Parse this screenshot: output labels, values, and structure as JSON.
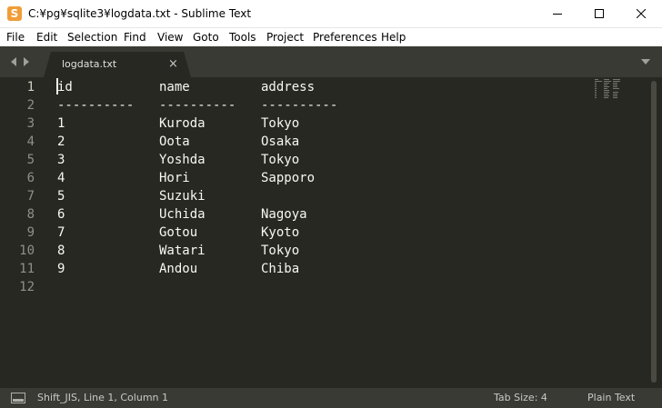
{
  "window": {
    "title": "C:¥pg¥sqlite3¥logdata.txt - Sublime Text",
    "app_icon_letter": "S"
  },
  "menu": [
    {
      "label": "File"
    },
    {
      "label": "Edit"
    },
    {
      "label": "Selection"
    },
    {
      "label": "Find"
    },
    {
      "label": "View"
    },
    {
      "label": "Goto"
    },
    {
      "label": "Tools"
    },
    {
      "label": "Project"
    },
    {
      "label": "Preferences"
    },
    {
      "label": "Help"
    }
  ],
  "tab": {
    "label": "logdata.txt",
    "close_glyph": "×"
  },
  "editor": {
    "line_numbers": [
      "1",
      "2",
      "3",
      "4",
      "5",
      "6",
      "7",
      "8",
      "9",
      "10",
      "11",
      "12"
    ],
    "rows": [
      {
        "id": "id",
        "name": "name",
        "address": "address"
      },
      {
        "id": "----------",
        "name": "----------",
        "address": "----------"
      },
      {
        "id": "1",
        "name": "Kuroda",
        "address": "Tokyo"
      },
      {
        "id": "2",
        "name": "Oota",
        "address": "Osaka"
      },
      {
        "id": "3",
        "name": "Yoshda",
        "address": "Tokyo"
      },
      {
        "id": "4",
        "name": "Hori",
        "address": "Sapporo"
      },
      {
        "id": "5",
        "name": "Suzuki",
        "address": ""
      },
      {
        "id": "6",
        "name": "Uchida",
        "address": "Nagoya"
      },
      {
        "id": "7",
        "name": "Gotou",
        "address": "Kyoto"
      },
      {
        "id": "8",
        "name": "Watari",
        "address": "Tokyo"
      },
      {
        "id": "9",
        "name": "Andou",
        "address": "Chiba"
      },
      {
        "id": "",
        "name": "",
        "address": ""
      }
    ]
  },
  "status": {
    "encoding_position": "Shift_JIS, Line 1, Column 1",
    "tab_size": "Tab Size: 4",
    "syntax": "Plain Text"
  },
  "colors": {
    "editor_bg": "#272822",
    "chrome_bg": "#3a3a34",
    "text": "#f8f8f2",
    "line_number": "#8f908a",
    "app_icon": "#f19d37"
  }
}
